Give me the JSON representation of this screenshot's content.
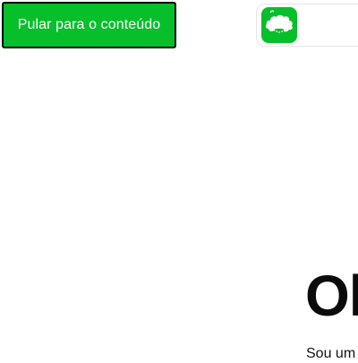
{
  "skip_link": {
    "label": "Pular para o conteúdo"
  },
  "header": {
    "logo": {
      "icon": "cloud-tree-icon",
      "color": "#07bf2b"
    }
  },
  "hero": {
    "title": "Ol",
    "subtitle": "Sou um"
  },
  "colors": {
    "accent": "#07bf2b",
    "text": "#0b0b0b"
  }
}
